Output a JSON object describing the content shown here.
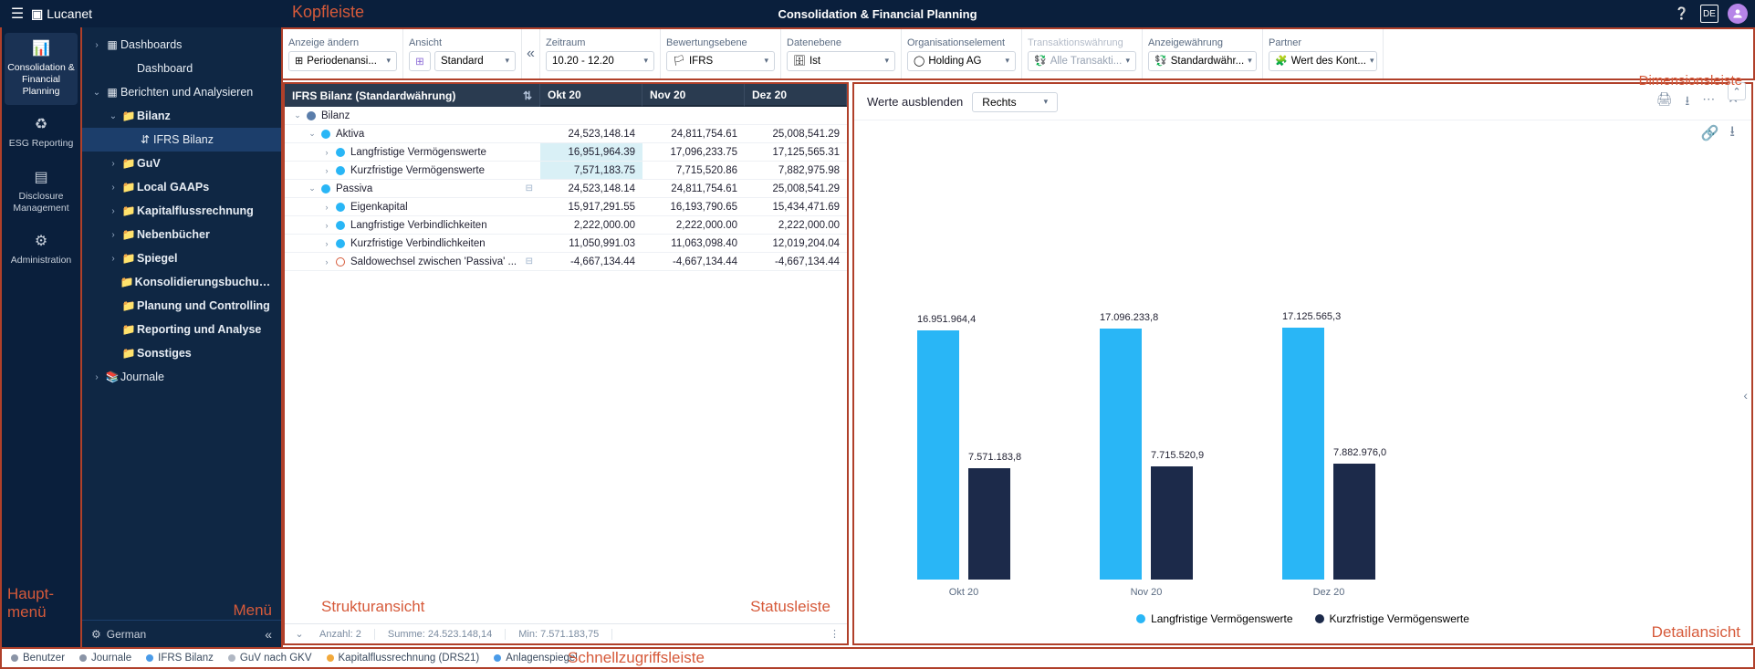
{
  "header": {
    "brand": "Lucanet",
    "title": "Consolidation & Financial Planning",
    "lang_badge": "DE"
  },
  "annotations": {
    "kopfleiste": "Kopfleiste",
    "dimensionsleiste": "Dimensionsleiste",
    "hauptmenu_l1": "Haupt-",
    "hauptmenu_l2": "menü",
    "menu": "Menü",
    "struktur": "Strukturansicht",
    "status": "Statusleiste",
    "detail": "Detailansicht",
    "quick": "Schnellzugriffsleiste"
  },
  "mainmenu": {
    "items": [
      {
        "label": "Consolidation & Financial Planning"
      },
      {
        "label": "ESG Reporting"
      },
      {
        "label": "Disclosure Management"
      },
      {
        "label": "Administration"
      }
    ]
  },
  "secmenu": {
    "footer_lang": "German",
    "tree": [
      {
        "indent": 0,
        "chev": "›",
        "icon": "▦",
        "label": "Dashboards"
      },
      {
        "indent": 1,
        "chev": "",
        "icon": "",
        "label": "Dashboard"
      },
      {
        "indent": 0,
        "chev": "⌄",
        "icon": "▦",
        "label": "Berichten und Analysieren"
      },
      {
        "indent": 1,
        "chev": "⌄",
        "icon": "📁",
        "label": "Bilanz",
        "bold": true
      },
      {
        "indent": 2,
        "chev": "",
        "icon": "⇵",
        "label": "IFRS Bilanz",
        "selected": true
      },
      {
        "indent": 1,
        "chev": "›",
        "icon": "📁",
        "label": "GuV",
        "bold": true
      },
      {
        "indent": 1,
        "chev": "›",
        "icon": "📁",
        "label": "Local GAAPs",
        "bold": true
      },
      {
        "indent": 1,
        "chev": "›",
        "icon": "📁",
        "label": "Kapitalflussrechnung",
        "bold": true
      },
      {
        "indent": 1,
        "chev": "›",
        "icon": "📁",
        "label": "Nebenbücher",
        "bold": true
      },
      {
        "indent": 1,
        "chev": "›",
        "icon": "📁",
        "label": "Spiegel",
        "bold": true
      },
      {
        "indent": 1,
        "chev": "",
        "icon": "📁",
        "label": "Konsolidierungsbuchungen",
        "bold": true
      },
      {
        "indent": 1,
        "chev": "",
        "icon": "📁",
        "label": "Planung und Controlling",
        "bold": true
      },
      {
        "indent": 1,
        "chev": "",
        "icon": "📁",
        "label": "Reporting und Analyse",
        "bold": true
      },
      {
        "indent": 1,
        "chev": "",
        "icon": "📁",
        "label": "Sonstiges",
        "bold": true
      },
      {
        "indent": 0,
        "chev": "›",
        "icon": "📚",
        "label": "Journale"
      }
    ]
  },
  "dimbar": {
    "groups": [
      {
        "label": "Anzeige ändern",
        "value": "Periodenansi...",
        "icon": "⊞"
      },
      {
        "label": "Ansicht",
        "value": "Standard",
        "icon": ""
      },
      {
        "label": "Zeitraum",
        "value": "10.20 - 12.20",
        "icon": "",
        "after_collapse": true
      },
      {
        "label": "Bewertungsebene",
        "value": "IFRS",
        "icon": "🏳"
      },
      {
        "label": "Datenebene",
        "value": "Ist",
        "icon": "🗄"
      },
      {
        "label": "Organisationselement",
        "value": "Holding AG",
        "icon": "◯"
      },
      {
        "label": "Transaktionswährung",
        "value": "Alle Transakti...",
        "icon": "💱",
        "muted": true
      },
      {
        "label": "Anzeigewährung",
        "value": "Standardwähr...",
        "icon": "💱"
      },
      {
        "label": "Partner",
        "value": "Wert des Kont...",
        "icon": "🧩"
      }
    ],
    "view_toggle_icon": "⬚"
  },
  "grid": {
    "header_title": "IFRS Bilanz (Standardwährung)",
    "cols": [
      "Okt 20",
      "Nov 20",
      "Dez 20"
    ],
    "rows": [
      {
        "indent": 0,
        "chev": "⌄",
        "dot": "folder",
        "label": "Bilanz",
        "v": [
          "",
          "",
          ""
        ]
      },
      {
        "indent": 1,
        "chev": "⌄",
        "dot": "blue",
        "label": "Aktiva",
        "v": [
          "24,523,148.14",
          "24,811,754.61",
          "25,008,541.29"
        ]
      },
      {
        "indent": 2,
        "chev": "›",
        "dot": "blue",
        "label": "Langfristige Vermögenswerte",
        "v": [
          "16,951,964.39",
          "17,096,233.75",
          "17,125,565.31"
        ],
        "hl": true
      },
      {
        "indent": 2,
        "chev": "›",
        "dot": "blue",
        "label": "Kurzfristige Vermögenswerte",
        "v": [
          "7,571,183.75",
          "7,715,520.86",
          "7,882,975.98"
        ],
        "hl": true
      },
      {
        "indent": 1,
        "chev": "⌄",
        "dot": "blue",
        "label": "Passiva",
        "badge": "⊟",
        "v": [
          "24,523,148.14",
          "24,811,754.61",
          "25,008,541.29"
        ]
      },
      {
        "indent": 2,
        "chev": "›",
        "dot": "blue",
        "label": "Eigenkapital",
        "v": [
          "15,917,291.55",
          "16,193,790.65",
          "15,434,471.69"
        ]
      },
      {
        "indent": 2,
        "chev": "›",
        "dot": "blue",
        "label": "Langfristige Verbindlichkeiten",
        "v": [
          "2,222,000.00",
          "2,222,000.00",
          "2,222,000.00"
        ]
      },
      {
        "indent": 2,
        "chev": "›",
        "dot": "blue",
        "label": "Kurzfristige Verbindlichkeiten",
        "v": [
          "11,050,991.03",
          "11,063,098.40",
          "12,019,204.04"
        ]
      },
      {
        "indent": 2,
        "chev": "›",
        "dot": "cal",
        "label": "Saldowechsel zwischen 'Passiva' ...",
        "badge": "⊟",
        "v": [
          "-4,667,134.44",
          "-4,667,134.44",
          "-4,667,134.44"
        ]
      }
    ]
  },
  "statusbar": {
    "anzahl": "Anzahl: 2",
    "summe": "Summe: 24.523.148,14",
    "min": "Min: 7.571.183,75"
  },
  "detail": {
    "hide_label": "Werte ausblenden",
    "align_value": "Rechts",
    "legend": [
      "Langfristige Vermögenswerte",
      "Kurzfristige Vermögenswerte"
    ]
  },
  "chart_data": {
    "type": "bar",
    "categories": [
      "Okt 20",
      "Nov 20",
      "Dez 20"
    ],
    "series": [
      {
        "name": "Langfristige Vermögenswerte",
        "values": [
          16951964.4,
          17096233.8,
          17125565.3
        ],
        "labels": [
          "16.951.964,4",
          "17.096.233,8",
          "17.125.565,3"
        ],
        "color": "#29b6f6"
      },
      {
        "name": "Kurzfristige Vermögenswerte",
        "values": [
          7571183.8,
          7715520.9,
          7882976.0
        ],
        "labels": [
          "7.571.183,8",
          "7.715.520,9",
          "7.882.976,0"
        ],
        "color": "#1c2a4a"
      }
    ],
    "ylim": [
      0,
      18000000
    ]
  },
  "quickbar": {
    "items": [
      {
        "color": "#8a94a6",
        "label": "Benutzer"
      },
      {
        "color": "#8a94a6",
        "label": "Journale"
      },
      {
        "color": "#4a9be8",
        "label": "IFRS Bilanz"
      },
      {
        "color": "#b0b7c3",
        "label": "GuV nach GKV"
      },
      {
        "color": "#f2a93b",
        "label": "Kapitalflussrechnung (DRS21)"
      },
      {
        "color": "#4a9be8",
        "label": "Anlagenspiegel"
      }
    ]
  }
}
